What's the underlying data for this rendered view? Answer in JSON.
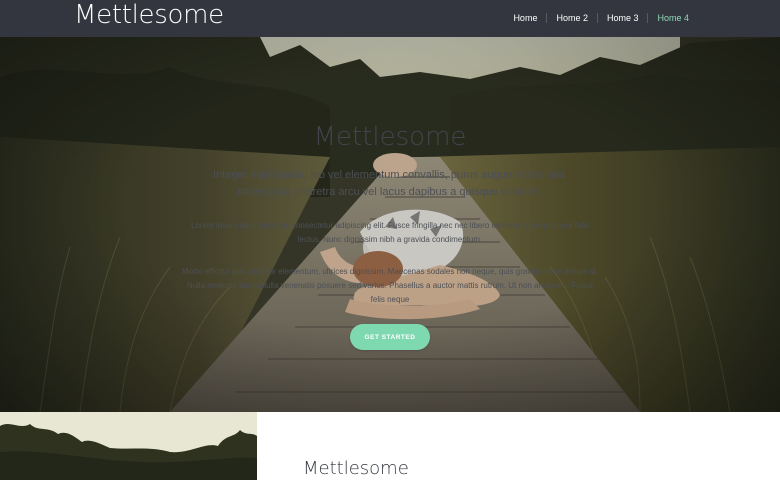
{
  "navbar": {
    "brand": "Mettlesome",
    "links": [
      {
        "label": "Home",
        "active": false
      },
      {
        "label": "Home 2",
        "active": false
      },
      {
        "label": "Home 3",
        "active": false
      },
      {
        "label": "Home 4",
        "active": true
      }
    ]
  },
  "hero": {
    "title": "Mettlesome",
    "lead": "Integer malesuada, leo vel elementum convallis, purus augue mattis nisi, malesuada pharetra arcu vel lacus dapibus a quisque volutpat.",
    "paragraph_1": "Lorem ipsum dolor sit amet, consectetur adipiscing elit. Fusce fringilla nec nec libero eleifend, eges posuere felis lectus. Nunc dignissim nibh a gravida condimentum.",
    "paragraph_2": "Morbi efficitur quis porttitor elementum, ultrices dignissim. Maecenas sodales non neque, quis gravida enim dictum id. Nulla molestie lorem nulla venenatis posuere sed varius. Phasellus a auctor mattis rutrum. Ut non arcu sem. Fusce felis neque",
    "cta_label": "GET STARTED"
  },
  "lower": {
    "title": "Mettlesome"
  },
  "colors": {
    "navbar_bg": "#33363e",
    "accent": "#7fd9b0",
    "active_link": "#8ed8b6"
  }
}
